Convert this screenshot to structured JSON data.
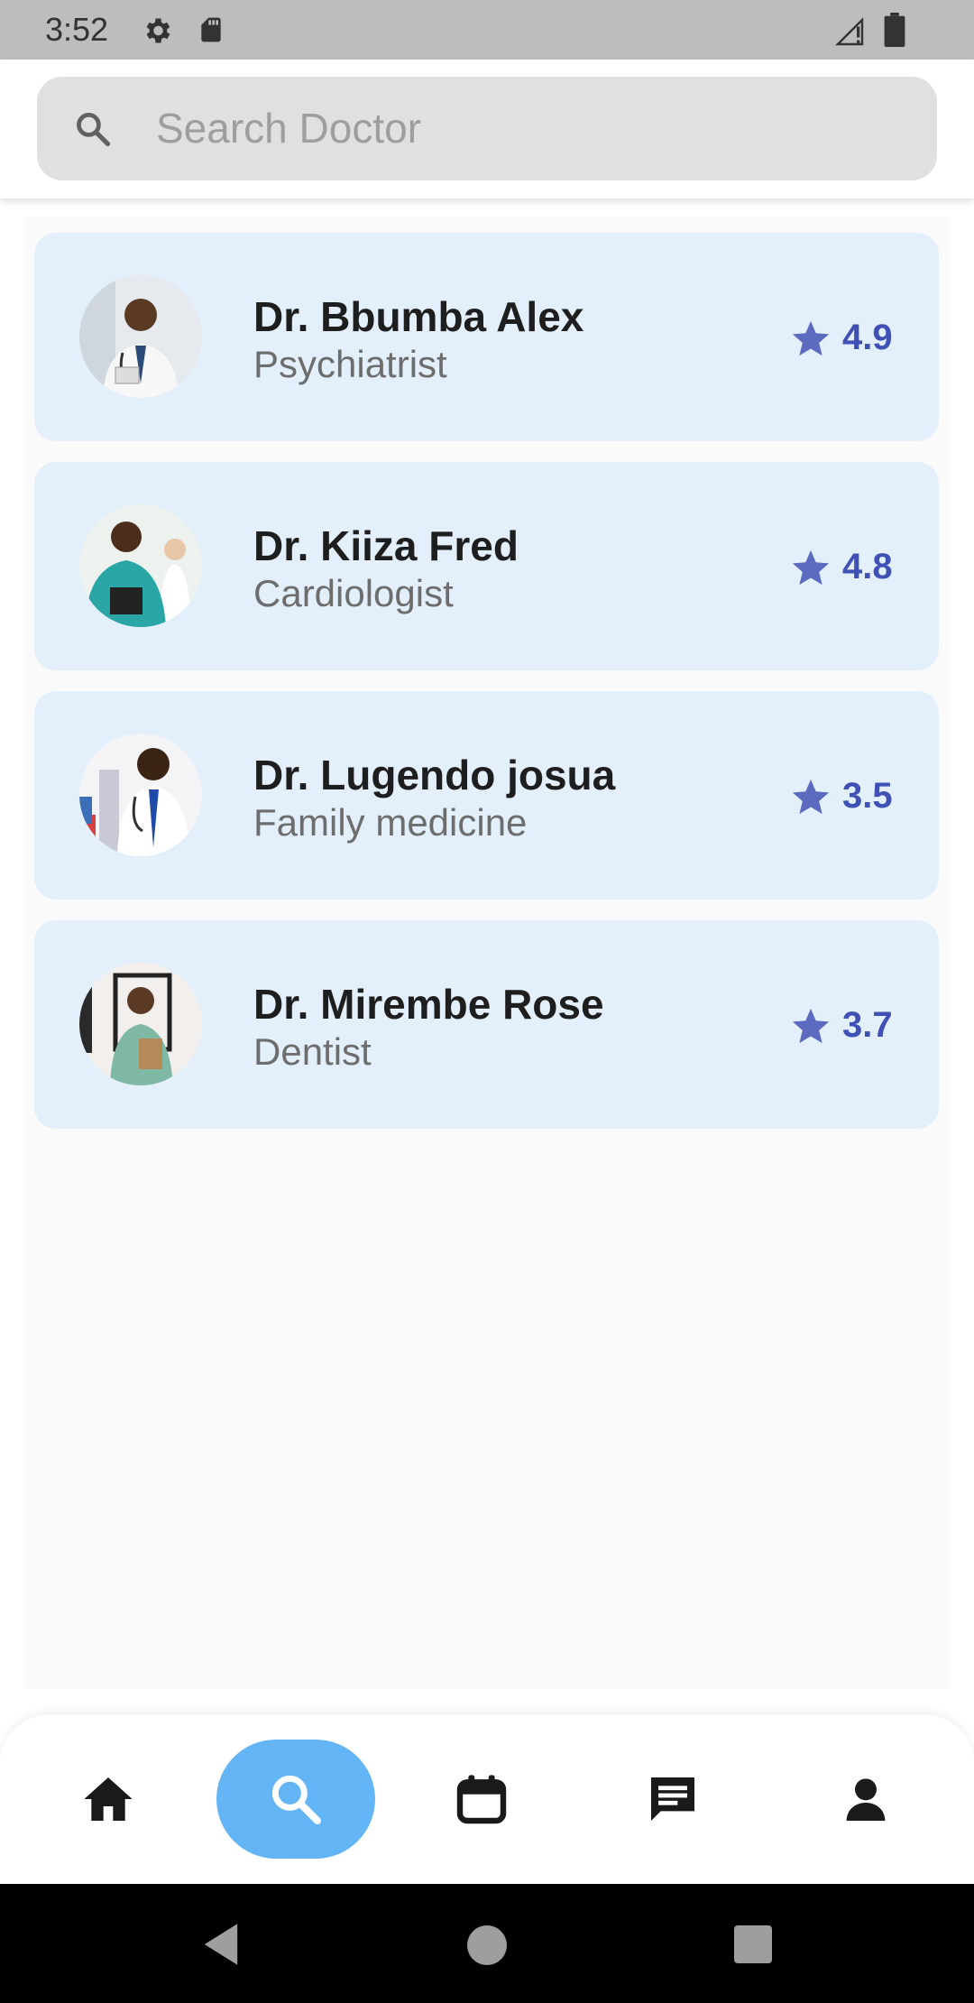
{
  "status_bar": {
    "time": "3:52"
  },
  "search": {
    "placeholder": "Search Doctor",
    "value": ""
  },
  "doctors": [
    {
      "name": "Dr. Bbumba Alex",
      "specialty": "Psychiatrist",
      "rating": "4.9"
    },
    {
      "name": "Dr. Kiiza Fred",
      "specialty": "Cardiologist",
      "rating": "4.8"
    },
    {
      "name": "Dr. Lugendo josua",
      "specialty": "Family medicine",
      "rating": "3.5"
    },
    {
      "name": "Dr. Mirembe Rose",
      "specialty": "Dentist",
      "rating": "3.7"
    }
  ],
  "bottom_nav": {
    "items": [
      {
        "icon": "home-icon"
      },
      {
        "icon": "search-icon",
        "active": true
      },
      {
        "icon": "calendar-icon"
      },
      {
        "icon": "chat-icon"
      },
      {
        "icon": "person-icon"
      }
    ]
  },
  "colors": {
    "card_bg": "#e3f0fc",
    "rating_accent": "#3f51b5",
    "star": "#5c6bc0",
    "nav_active": "#64b5f6"
  }
}
